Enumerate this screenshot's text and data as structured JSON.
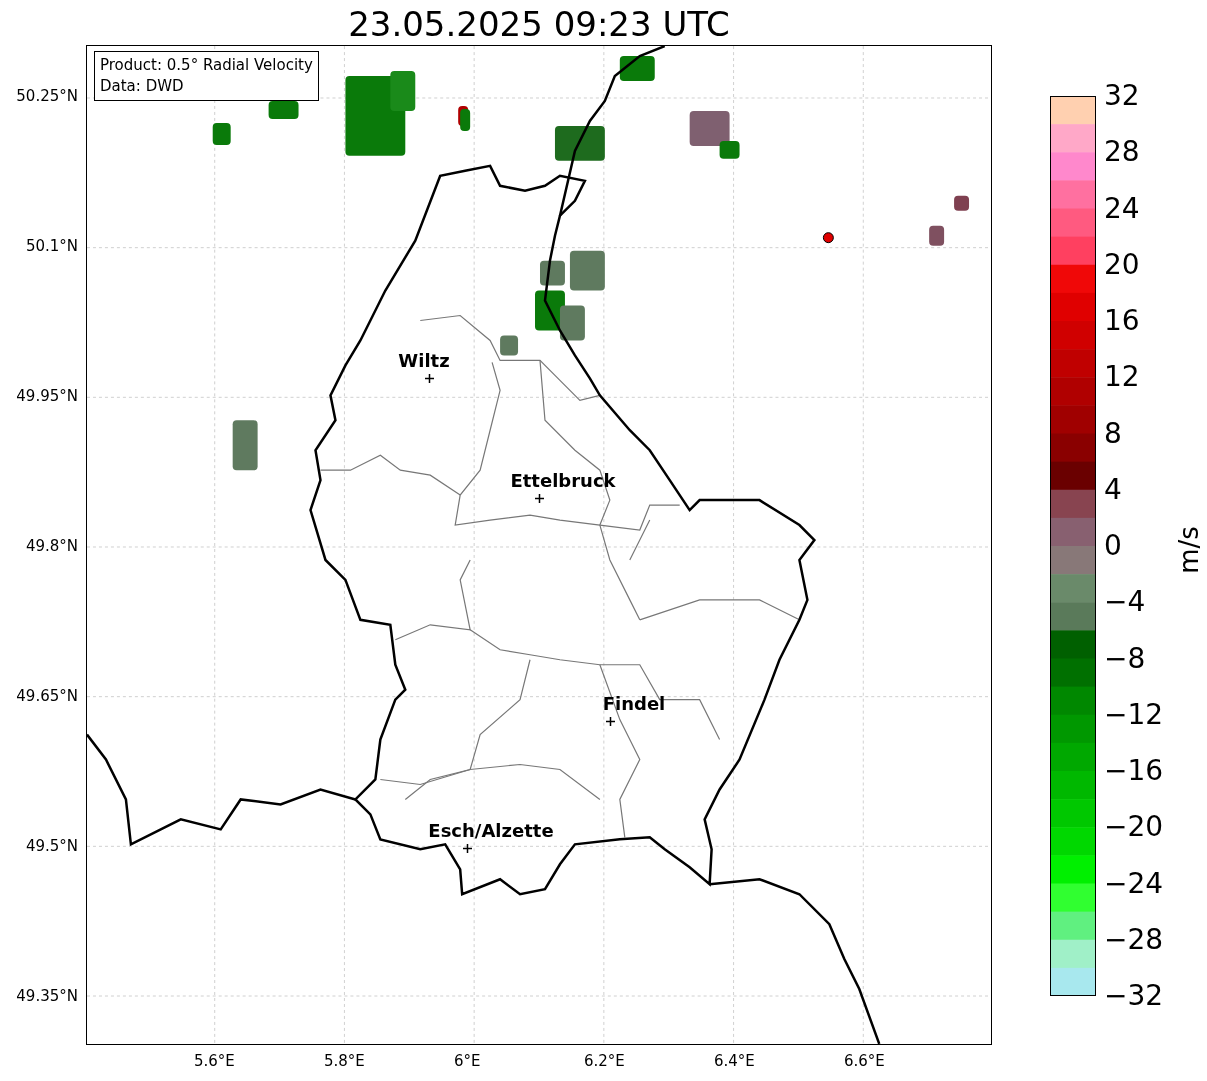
{
  "title": "23.05.2025 09:23 UTC",
  "info_box": {
    "lines": [
      "Product: 0.5° Radial Velocity",
      "Data: DWD"
    ]
  },
  "y_ticks": [
    "50.25°N",
    "50.1°N",
    "49.95°N",
    "49.8°N",
    "49.65°N",
    "49.5°N",
    "49.35°N"
  ],
  "x_ticks": [
    "5.6°E",
    "5.8°E",
    "6°E",
    "6.2°E",
    "6.4°E",
    "6.6°E"
  ],
  "cities": [
    {
      "name": "Wiltz"
    },
    {
      "name": "Ettelbruck"
    },
    {
      "name": "Findel"
    },
    {
      "name": "Esch/Alzette"
    }
  ],
  "colorbar": {
    "label": "m/s",
    "ticks": [
      "32",
      "28",
      "24",
      "20",
      "16",
      "12",
      "8",
      "4",
      "0",
      "−4",
      "−8",
      "−12",
      "−16",
      "−20",
      "−24",
      "−28",
      "−32"
    ]
  }
}
